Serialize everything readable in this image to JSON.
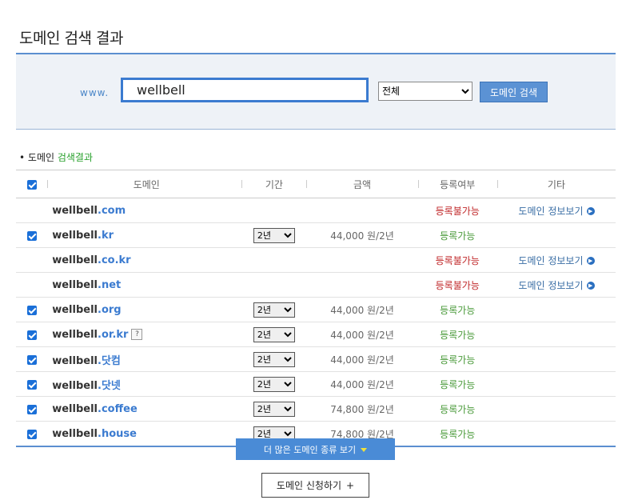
{
  "page": {
    "title": "도메인 검색 결과"
  },
  "search": {
    "prefix": "www.",
    "query": "wellbell",
    "tld_selected": "전체",
    "tld_options": [
      "전체"
    ],
    "button_label": "도메인 검색"
  },
  "results": {
    "section_title_prefix": "도메인 ",
    "section_title_accent": "검색결과",
    "headers": {
      "domain": "도메인",
      "period": "기간",
      "price": "금액",
      "status": "등록여부",
      "etc": "기타"
    },
    "rows": [
      {
        "name": "wellbell",
        "tld": ".com",
        "checkbox": false,
        "period": "",
        "price": "",
        "status": "등록불가능",
        "available": false,
        "info": "도메인 정보보기",
        "help": false
      },
      {
        "name": "wellbell",
        "tld": ".kr",
        "checkbox": true,
        "period": "2년",
        "price": "44,000 원/2년",
        "status": "등록가능",
        "available": true,
        "info": "",
        "help": false
      },
      {
        "name": "wellbell",
        "tld": ".co.kr",
        "checkbox": false,
        "period": "",
        "price": "",
        "status": "등록불가능",
        "available": false,
        "info": "도메인 정보보기",
        "help": false
      },
      {
        "name": "wellbell",
        "tld": ".net",
        "checkbox": false,
        "period": "",
        "price": "",
        "status": "등록불가능",
        "available": false,
        "info": "도메인 정보보기",
        "help": false
      },
      {
        "name": "wellbell",
        "tld": ".org",
        "checkbox": true,
        "period": "2년",
        "price": "44,000 원/2년",
        "status": "등록가능",
        "available": true,
        "info": "",
        "help": false
      },
      {
        "name": "wellbell",
        "tld": ".or.kr",
        "checkbox": true,
        "period": "2년",
        "price": "44,000 원/2년",
        "status": "등록가능",
        "available": true,
        "info": "",
        "help": true
      },
      {
        "name": "wellbell",
        "tld": ".닷컴",
        "checkbox": true,
        "period": "2년",
        "price": "44,000 원/2년",
        "status": "등록가능",
        "available": true,
        "info": "",
        "help": false
      },
      {
        "name": "wellbell",
        "tld": ".닷넷",
        "checkbox": true,
        "period": "2년",
        "price": "44,000 원/2년",
        "status": "등록가능",
        "available": true,
        "info": "",
        "help": false
      },
      {
        "name": "wellbell",
        "tld": ".coffee",
        "checkbox": true,
        "period": "2년",
        "price": "74,800 원/2년",
        "status": "등록가능",
        "available": true,
        "info": "",
        "help": false
      },
      {
        "name": "wellbell",
        "tld": ".house",
        "checkbox": true,
        "period": "2년",
        "price": "74,800 원/2년",
        "status": "등록가능",
        "available": true,
        "info": "",
        "help": false
      }
    ],
    "help_label": "?",
    "arrow_glyph": "▶"
  },
  "more_button": {
    "label": "더 많은 도메인 종류 보기"
  },
  "apply_button": {
    "label": "도메인 신청하기",
    "plus": "+"
  },
  "colors": {
    "accent": "#3b7bd0",
    "unavailable": "#c0282a",
    "available": "#4a9a3a",
    "section_accent": "#27a02b"
  }
}
